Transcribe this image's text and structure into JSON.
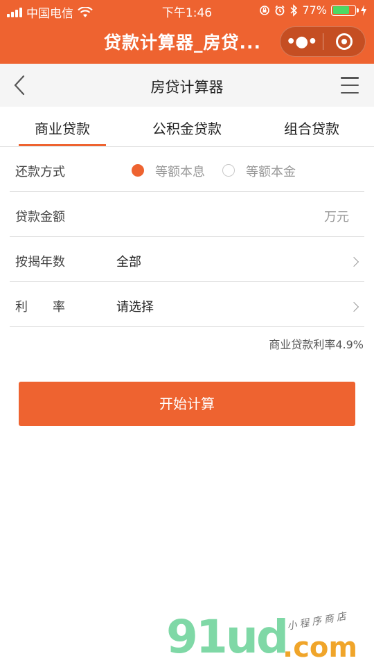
{
  "status_bar": {
    "carrier": "中国电信",
    "time": "下午1:46",
    "battery": "77%",
    "battery_level": 0.77
  },
  "title_bar": {
    "title": "贷款计算器_房贷..."
  },
  "nav": {
    "title": "房贷计算器"
  },
  "tabs": [
    {
      "label": "商业贷款",
      "active": true
    },
    {
      "label": "公积金贷款",
      "active": false
    },
    {
      "label": "组合贷款",
      "active": false
    }
  ],
  "form": {
    "repayment": {
      "label": "还款方式",
      "options": [
        {
          "label": "等额本息",
          "selected": true
        },
        {
          "label": "等额本金",
          "selected": false
        }
      ]
    },
    "amount": {
      "label": "贷款金额",
      "value": "",
      "unit": "万元"
    },
    "years": {
      "label": "按揭年数",
      "value": "全部"
    },
    "rate": {
      "label": "利　　率",
      "value": "请选择"
    },
    "rate_note": "商业贷款利率4.9%"
  },
  "button": {
    "label": "开始计算"
  },
  "watermark": {
    "main": "91ud",
    "suffix": ".com",
    "small": "小程序商店"
  },
  "colors": {
    "accent": "#ee6330",
    "battery": "#4cd964"
  }
}
